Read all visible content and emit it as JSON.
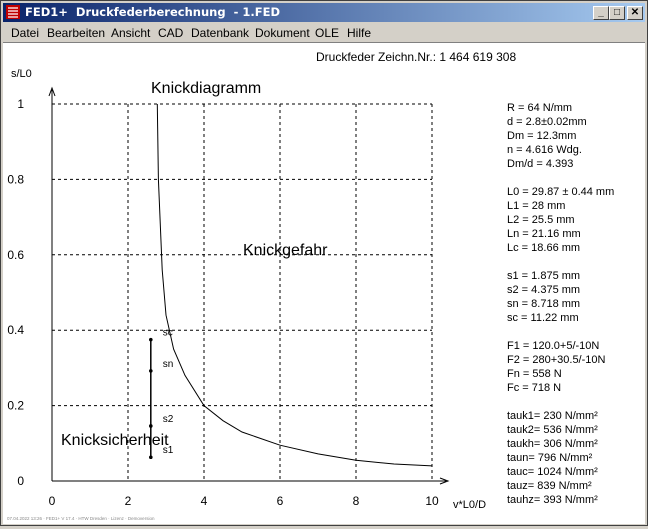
{
  "window": {
    "title": "FED1+  Druckfederberechnung  - 1.FED",
    "controls": {
      "minimize": "_",
      "maximize": "□",
      "close": "✕"
    }
  },
  "menu": [
    "Datei",
    "Bearbeiten",
    "Ansicht",
    "CAD",
    "Datenbank",
    "Dokument",
    "OLE",
    "Hilfe"
  ],
  "header": {
    "text": "Druckfeder   Zeichn.Nr.: 1 464 619 308"
  },
  "chart_data": {
    "type": "line",
    "title": "Knickdiagramm",
    "xlabel": "v*L0/D",
    "ylabel": "s/L0",
    "xlim": [
      0,
      10
    ],
    "ylim": [
      0,
      1
    ],
    "xticks": [
      "0",
      "2",
      "4",
      "6",
      "8",
      "10"
    ],
    "yticks": [
      "0",
      "0.2",
      "0.4",
      "0.6",
      "0.8",
      "1"
    ],
    "grid": true,
    "regions": {
      "danger": "Knickgefahr",
      "safe": "Knicksicherheit"
    },
    "curve": {
      "x": [
        2.77,
        2.8,
        2.9,
        3.0,
        3.2,
        3.5,
        4.0,
        4.5,
        5.0,
        6.0,
        7.0,
        8.0,
        9.0,
        10.0
      ],
      "y": [
        1.0,
        0.8,
        0.56,
        0.44,
        0.35,
        0.28,
        0.2,
        0.16,
        0.13,
        0.095,
        0.072,
        0.055,
        0.045,
        0.04
      ]
    },
    "spring_x": 2.6,
    "points": [
      {
        "label": "s1",
        "y": 0.063
      },
      {
        "label": "s2",
        "y": 0.146
      },
      {
        "label": "sn",
        "y": 0.292
      },
      {
        "label": "sc",
        "y": 0.375
      }
    ]
  },
  "properties": [
    {
      "label": "R = 64 N/mm",
      "group": 1
    },
    {
      "label": "d = 2.8±0.02mm",
      "group": 1
    },
    {
      "label": "Dm = 12.3mm",
      "group": 1
    },
    {
      "label": "n = 4.616 Wdg.",
      "group": 1
    },
    {
      "label": "Dm/d = 4.393",
      "group": 1
    },
    {
      "label": "L0 = 29.87 ± 0.44 mm",
      "group": 2
    },
    {
      "label": "L1 = 28 mm",
      "group": 2
    },
    {
      "label": "L2 = 25.5 mm",
      "group": 2
    },
    {
      "label": "Ln = 21.16 mm",
      "group": 2
    },
    {
      "label": "Lc = 18.66 mm",
      "group": 2
    },
    {
      "label": "s1 = 1.875 mm",
      "group": 3
    },
    {
      "label": "s2 = 4.375 mm",
      "group": 3
    },
    {
      "label": "sn = 8.718 mm",
      "group": 3
    },
    {
      "label": "sc = 11.22 mm",
      "group": 3
    },
    {
      "label": "F1 = 120.0+5/-10N",
      "group": 4
    },
    {
      "label": "F2 = 280+30.5/-10N",
      "group": 4
    },
    {
      "label": "Fn = 558 N",
      "group": 4
    },
    {
      "label": "Fc = 718 N",
      "group": 4
    },
    {
      "label": "tauk1=  230 N/mm²",
      "group": 5
    },
    {
      "label": "tauk2=  536 N/mm²",
      "group": 5
    },
    {
      "label": "taukh=  306 N/mm²",
      "group": 5
    },
    {
      "label": "taun=  796 N/mm²",
      "group": 5
    },
    {
      "label": "tauc= 1024 N/mm²",
      "group": 5
    },
    {
      "label": "tauz=  839 N/mm²",
      "group": 5
    },
    {
      "label": "tauhz=  393 N/mm²",
      "group": 5
    }
  ],
  "footer": {
    "text": "07.04.2022 13:26 · FED1+ V 17.4 · HTW Dresden · Lizenz · Demoversion"
  },
  "colors": {
    "title_start": "#0a246a",
    "title_end": "#a6caf0",
    "chrome": "#d4d0c8",
    "canvas": "#ffffff"
  }
}
